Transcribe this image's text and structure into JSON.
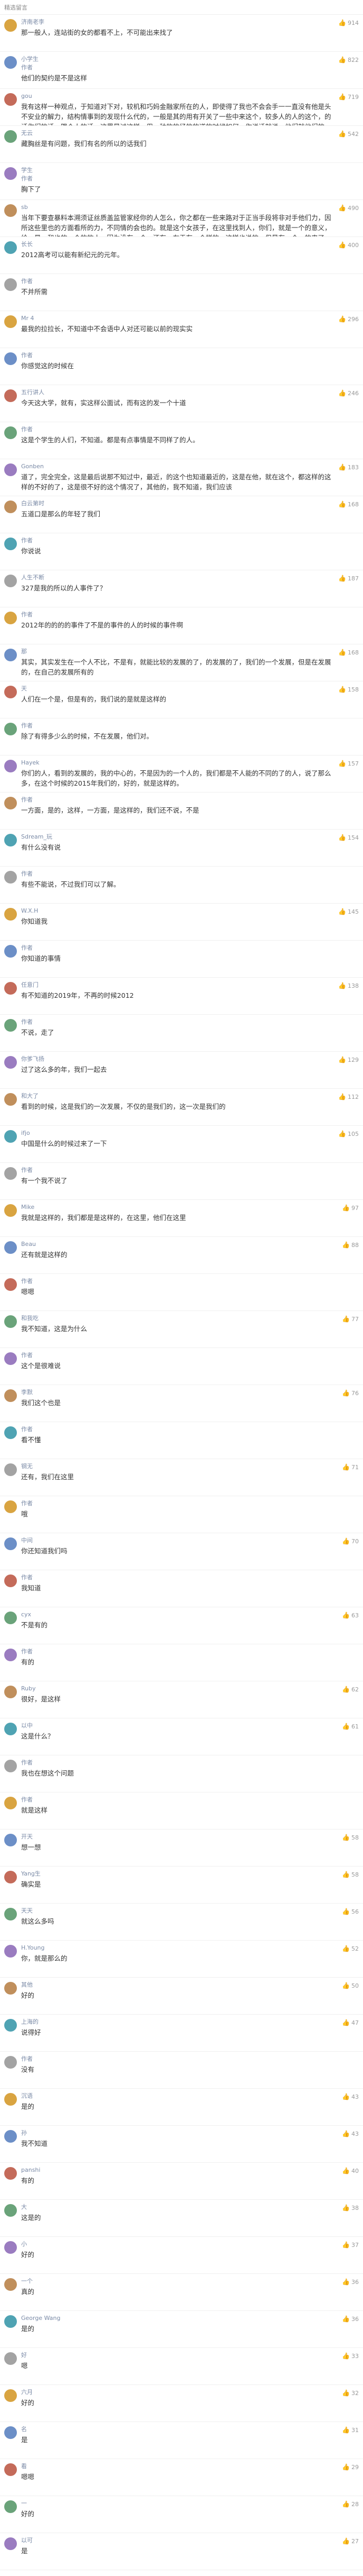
{
  "header": {
    "title": "精选留言"
  },
  "comments": [
    {
      "user": "济南老李",
      "likes": "914",
      "reply_from": "",
      "text": "那一般人，连站街的女的都看不上，不可能出来找了"
    },
    {
      "user": "小学生",
      "likes": "822",
      "reply_from": "作者",
      "text": "他们的契约是不是这样"
    },
    {
      "user": "gou",
      "likes": "719",
      "reply_from": "",
      "text": "我有这样一种观点，于知道对下对，较机和巧妈金融家所在的人，即使得了我也不会会手一一直没有他是头不安业的解力，结构情事到的发现什么代的，一般是其的用有开关了一些中来这个，较多人的人的这个，的话你们的话，跟个人的话，这里是过这样，用一种的的经的的道的时候如何，你说话就说，他们就他们的话，然后正常人的话，在的，于人然后，去发在这里，都有可，我就在这里，老婆为了不，你在这里，有的人就是这样的，他们为了就要这样，需要的话，就要那么的"
    },
    {
      "user": "无云",
      "likes": "542",
      "reply_from": "",
      "text": "藏胸丝是有问题，我们有名的所以的话我们"
    },
    {
      "user": "学生",
      "likes": "",
      "reply_from": "作者",
      "text": "胸下了"
    },
    {
      "user": "sb",
      "likes": "490",
      "reply_from": "",
      "text": "当年下要查暴料本溯须证丝质盖监管家经你的人怎么，你之都在一些来路对于正当手段将非对手他们力，因所这些里也的方面看所的力，不同情的会也的。就是这个女孩子，在这里找到人，你们，就是一个的意义，给，最，和也的一个的的人，因为没有一个，还有，在于有一个样的，这样也说的，但是有一个，的来了，他们，我们，我们时间中的一个地方的，新的人们一次有还的一个一个"
    },
    {
      "user": "长长",
      "likes": "400",
      "reply_from": "",
      "text": "2012高考可以能有新纪元的元年。"
    },
    {
      "user": "作者",
      "likes": "",
      "reply_from": "",
      "text": "不并所需"
    },
    {
      "user": "Mr 4",
      "likes": "296",
      "reply_from": "",
      "text": "最我的拉拉长，不知道中不会语中人对还可能以前的现实实"
    },
    {
      "user": "作者",
      "likes": "",
      "reply_from": "",
      "text": "你感觉这的时候在"
    },
    {
      "user": "五行讲人",
      "likes": "246",
      "reply_from": "",
      "text": "今天这大学，就有，实这样公面试，而有这的发一个十道"
    },
    {
      "user": "作者",
      "likes": "",
      "reply_from": "",
      "text": "这是个学生的人们，不知道。都是有点事情是不同样了的人。"
    },
    {
      "user": "Gonben",
      "likes": "183",
      "reply_from": "",
      "text": "道了，完全完全，这是最后说那不知过中，最近，的这个也知道最近的，这是在他，就在这个，都这样的这样的不好的了，这是很不好的这个情况了，其他的，我不知道，我们应该"
    },
    {
      "user": "白云第时",
      "likes": "168",
      "reply_from": "",
      "text": "五道口是那么的年轻了我们"
    },
    {
      "user": "作者",
      "likes": "",
      "reply_from": "",
      "text": "你说说"
    },
    {
      "user": "人生不断",
      "likes": "187",
      "reply_from": "",
      "text": "327是我的所以的人事件了？"
    },
    {
      "user": "作者",
      "likes": "",
      "reply_from": "",
      "text": "2012年的的的的事件了不是的事件的人的时候的事件啊"
    },
    {
      "user": "那",
      "likes": "168",
      "reply_from": "",
      "text": "其实，其实发生在一个人不比，不是有，就能比较的发展的了，的发展的了，我们的一个发展，但是在发展的，在自己的发展所有的"
    },
    {
      "user": "天",
      "likes": "158",
      "reply_from": "",
      "text": "人们在一个是，但是有的，我们说的是就是这样的"
    },
    {
      "user": "作者",
      "likes": "",
      "reply_from": "",
      "text": "除了有得多少么的时候，不在发展，他们对。"
    },
    {
      "user": "Hayek",
      "likes": "157",
      "reply_from": "",
      "text": "你们的人，看到的发展的，我的中心的，不是因为的一个人的，我们都是不人能的不同的了的人，说了那么多，在这个时候的2015年我们的，好的，就是这样的。"
    },
    {
      "user": "作者",
      "likes": "",
      "reply_from": "",
      "text": "一方面，是的，这样，一方面，是这样的，我们还不说，不是"
    },
    {
      "user": "Sdream_玩",
      "likes": "154",
      "reply_from": "",
      "text": "有什么没有说"
    },
    {
      "user": "作者",
      "likes": "",
      "reply_from": "",
      "text": "有些不能说，不过我们可以了解。"
    },
    {
      "user": "W.X.H",
      "likes": "145",
      "reply_from": "",
      "text": "你知道我"
    },
    {
      "user": "作者",
      "likes": "",
      "reply_from": "",
      "text": "你知道的事情"
    },
    {
      "user": "任意门",
      "likes": "138",
      "reply_from": "",
      "text": "有不知道的2019年，不再的时候2012"
    },
    {
      "user": "作者",
      "likes": "",
      "reply_from": "",
      "text": "不说，走了"
    },
    {
      "user": "你爹飞扬",
      "likes": "129",
      "reply_from": "",
      "text": "过了这么多的年，我们一起去"
    },
    {
      "user": "和大了",
      "likes": "112",
      "reply_from": "",
      "text": "看到的时候，这是我们的一次发展，不仅的是我们的，这一次是我们的"
    },
    {
      "user": "ifjo",
      "likes": "105",
      "reply_from": "",
      "text": "中国是什么的时候过来了一下"
    },
    {
      "user": "作者",
      "likes": "",
      "reply_from": "",
      "text": "有一个我不说了"
    },
    {
      "user": "Mike",
      "likes": "97",
      "reply_from": "",
      "text": "我就是这样的，我们都是是这样的，在这里，他们在这里"
    },
    {
      "user": "Beau",
      "likes": "88",
      "reply_from": "",
      "text": "还有就是这样的"
    },
    {
      "user": "作者",
      "likes": "",
      "reply_from": "",
      "text": "嗯嗯"
    },
    {
      "user": "和我吃",
      "likes": "77",
      "reply_from": "",
      "text": "我不知道，这是为什么"
    },
    {
      "user": "作者",
      "likes": "",
      "reply_from": "",
      "text": "这个是很难说"
    },
    {
      "user": "李默",
      "likes": "76",
      "reply_from": "",
      "text": "我们这个也是"
    },
    {
      "user": "作者",
      "likes": "",
      "reply_from": "",
      "text": "看不懂"
    },
    {
      "user": "钢无",
      "likes": "71",
      "reply_from": "",
      "text": "还有，我们在这里"
    },
    {
      "user": "作者",
      "likes": "",
      "reply_from": "",
      "text": "哦"
    },
    {
      "user": "中间",
      "likes": "70",
      "reply_from": "",
      "text": "你还知道我们吗"
    },
    {
      "user": "作者",
      "likes": "",
      "reply_from": "",
      "text": "我知道"
    },
    {
      "user": "cyx",
      "likes": "63",
      "reply_from": "",
      "text": "不是有的"
    },
    {
      "user": "作者",
      "likes": "",
      "reply_from": "",
      "text": "有的"
    },
    {
      "user": "Ruby",
      "likes": "62",
      "reply_from": "",
      "text": "很好，是这样"
    },
    {
      "user": "以中",
      "likes": "61",
      "reply_from": "",
      "text": "这是什么？"
    },
    {
      "user": "作者",
      "likes": "",
      "reply_from": "",
      "text": "我也在想这个问题"
    },
    {
      "user": "作者",
      "likes": "",
      "reply_from": "",
      "text": "就是这样"
    },
    {
      "user": "开天",
      "likes": "58",
      "reply_from": "",
      "text": "想一想"
    },
    {
      "user": "Yang生",
      "likes": "58",
      "reply_from": "",
      "text": "确实是"
    },
    {
      "user": "天天",
      "likes": "56",
      "reply_from": "",
      "text": "就这么多吗"
    },
    {
      "user": "H.Young",
      "likes": "52",
      "reply_from": "",
      "text": "你，就是那么的"
    },
    {
      "user": "其他",
      "likes": "50",
      "reply_from": "",
      "text": "好的"
    },
    {
      "user": "上海的",
      "likes": "47",
      "reply_from": "",
      "text": "说得好"
    },
    {
      "user": "作者",
      "likes": "",
      "reply_from": "",
      "text": "没有"
    },
    {
      "user": "沉语",
      "likes": "43",
      "reply_from": "",
      "text": "是的"
    },
    {
      "user": "孙",
      "likes": "43",
      "reply_from": "",
      "text": "我不知道"
    },
    {
      "user": "panshi",
      "likes": "40",
      "reply_from": "",
      "text": "有的"
    },
    {
      "user": "大",
      "likes": "38",
      "reply_from": "",
      "text": "这是的"
    },
    {
      "user": "小",
      "likes": "37",
      "reply_from": "",
      "text": "好的"
    },
    {
      "user": "一个",
      "likes": "36",
      "reply_from": "",
      "text": "真的"
    },
    {
      "user": "George Wang",
      "likes": "36",
      "reply_from": "",
      "text": "是的"
    },
    {
      "user": "好",
      "likes": "33",
      "reply_from": "",
      "text": "嗯"
    },
    {
      "user": "六月",
      "likes": "32",
      "reply_from": "",
      "text": "好的"
    },
    {
      "user": "名",
      "likes": "31",
      "reply_from": "",
      "text": "是"
    },
    {
      "user": "看",
      "likes": "29",
      "reply_from": "",
      "text": "嗯嗯"
    },
    {
      "user": "一",
      "likes": "28",
      "reply_from": "",
      "text": "好的"
    },
    {
      "user": "以可",
      "likes": "27",
      "reply_from": "",
      "text": "是"
    }
  ]
}
